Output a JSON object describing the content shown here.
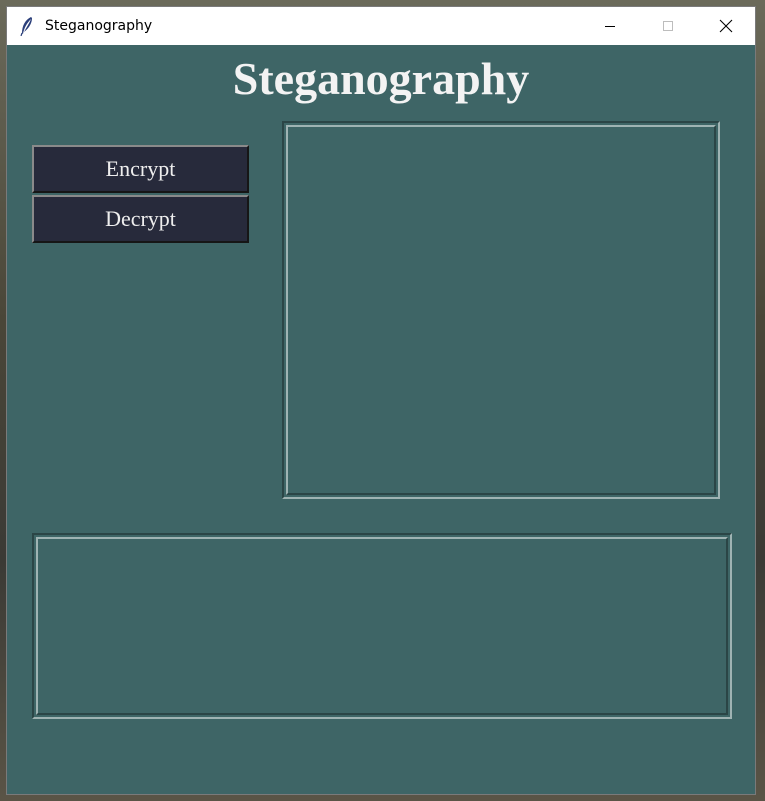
{
  "window": {
    "title": "Steganography",
    "controls": {
      "minimize": "minimize-icon",
      "maximize": "maximize-icon",
      "close": "close-icon"
    }
  },
  "main": {
    "heading": "Steganography",
    "buttons": {
      "encrypt_label": "Encrypt",
      "decrypt_label": "Decrypt"
    }
  },
  "colors": {
    "background": "#3e6566",
    "button_bg": "#272a3b",
    "text_light": "#f3f3f3"
  }
}
